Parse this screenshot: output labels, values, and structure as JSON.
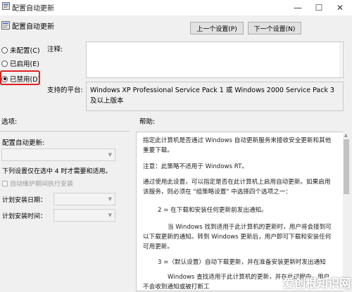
{
  "window": {
    "title": "配置自动更新",
    "icon": "policy-icon",
    "min_glyph": "—",
    "max_glyph": "☐",
    "close_glyph": "✕"
  },
  "header": {
    "title": "配置自动更新",
    "icon": "policy-icon"
  },
  "nav": {
    "prev_label": "上一个设置(P)",
    "next_label": "下一个设置(N)"
  },
  "state": {
    "options": [
      {
        "label": "未配置(C)",
        "checked": false
      },
      {
        "label": "已启用(E)",
        "checked": false
      },
      {
        "label": "已禁用(D)",
        "checked": true
      }
    ]
  },
  "comment": {
    "label": "注释:",
    "value": ""
  },
  "platform": {
    "label": "支持的平台:",
    "text": "Windows XP Professional Service Pack 1 或 Windows 2000 Service Pack 3 及以上版本"
  },
  "sections": {
    "options_label": "选项:",
    "help_label": "帮助:"
  },
  "options": {
    "configure_label": "配置自动更新:",
    "configure_value": "",
    "schedule_note": "下列设置仅在选中 4 时才需要和适用。",
    "maintenance_checkbox": "自动维护期间执行安装",
    "install_day_label": "计划安装日期：",
    "install_day_value": "",
    "install_time_label": "计划安装时间：",
    "install_time_value": ""
  },
  "help": {
    "paragraphs": [
      "指定此计算机是否通过 Windows 自动更新服务来接收安全更新和其他重要下载。",
      "注意：此策略不适用于 Windows RT。",
      "通过使用此设置，可以指定是否在此计算机上启用自动更新。如果启用该服务，则必须在 \"组策略设置\" 中选择四个选项之一：",
      "2 = 在下载和安装任何更新前发出通知。",
      "当 Windows 找到适用于此计算机的更新时，用户将会接到可以下载更新的通知。转到 Windows 更新后，用户即可下载和安装任何可用更新。",
      "3 =（默认设置）自动下载更新，并在准备安装更新时发出通知",
      "Windows 查找适用于此计算机的更新，并在此过程中，用户不会收到通知或被打断工"
    ]
  },
  "watermark": "爱创根知识网"
}
